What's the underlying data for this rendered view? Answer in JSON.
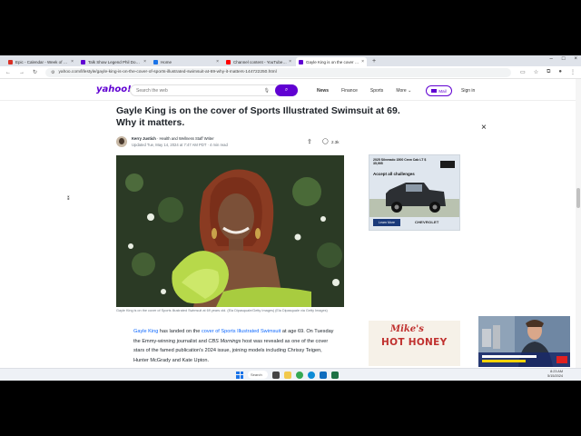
{
  "browser": {
    "tabs": [
      {
        "title": "Epic - Calendar - Week of M...",
        "color": "#d93025",
        "active": false
      },
      {
        "title": "Talk Show Legend Phil Donahu...",
        "color": "#6001d2",
        "active": false
      },
      {
        "title": "Home",
        "color": "#1a73e8",
        "active": false
      },
      {
        "title": "Channel content - YouTube St...",
        "color": "#ff0000",
        "active": false
      },
      {
        "title": "Gayle King is on the cover of S...",
        "color": "#6001d2",
        "active": true
      }
    ],
    "new_tab": "+",
    "url": "yahoo.com/lifestyle/gayle-king-is-on-the-cover-of-sports-illustrated-swimsuit-at-69-why-it-matters-144722250.html"
  },
  "yahoo": {
    "logo": "yahoo!",
    "search_placeholder": "Search the web",
    "nav": [
      {
        "label": "News",
        "active": true
      },
      {
        "label": "Finance",
        "active": false
      },
      {
        "label": "Sports",
        "active": false
      },
      {
        "label": "More ⌄",
        "active": false
      }
    ],
    "mail_label": "Mail",
    "signin_label": "Sign in"
  },
  "article": {
    "headline": "Gayle King is on the cover of Sports Illustrated Swimsuit at 69. Why it matters.",
    "author": "Kerry Justich",
    "author_role": "· Health and Wellness Staff Writer",
    "updated": "Updated Tue, May 14, 2024 at 7:47 AM PDT · 4 min read",
    "comment_count": "2.3k",
    "caption": "Gayle King is on the cover of Sports Illustrated Swimsuit at 69 years old. (Ela Dipasquale/Getty Images) (Ela Dipasquale via Getty Images)",
    "para_link1": "Gayle King",
    "para_text1": " has landed on the ",
    "para_link2": "cover of Sports Illustrated Swimsuit",
    "para_text2": " at age 69. On Tuesday the Emmy-winning journalist and ",
    "para_italic": "CBS Mornings",
    "para_text3": " host was revealed as one of the cover stars of the famed publication's 2024 issue, joining models including Chrissy Teigen, Hunter McGrady and Kate Upton."
  },
  "ads": {
    "ad1_title": "2025 Silverado 1500 Crew Cab LT $ 35,995",
    "ad1_headline": "Accept all challenges",
    "ad1_button": "Learn More",
    "ad1_brand": "CHEVROLET",
    "ad2_line1": "Mike's",
    "ad2_line2": "HOT HONEY"
  },
  "taskbar": {
    "search_label": "Search",
    "time": "8:23 AM",
    "date": "5/15/2024"
  },
  "colors": {
    "yahoo_purple": "#6001d2",
    "link_blue": "#0f69ff",
    "ad_red": "#c0312f"
  }
}
